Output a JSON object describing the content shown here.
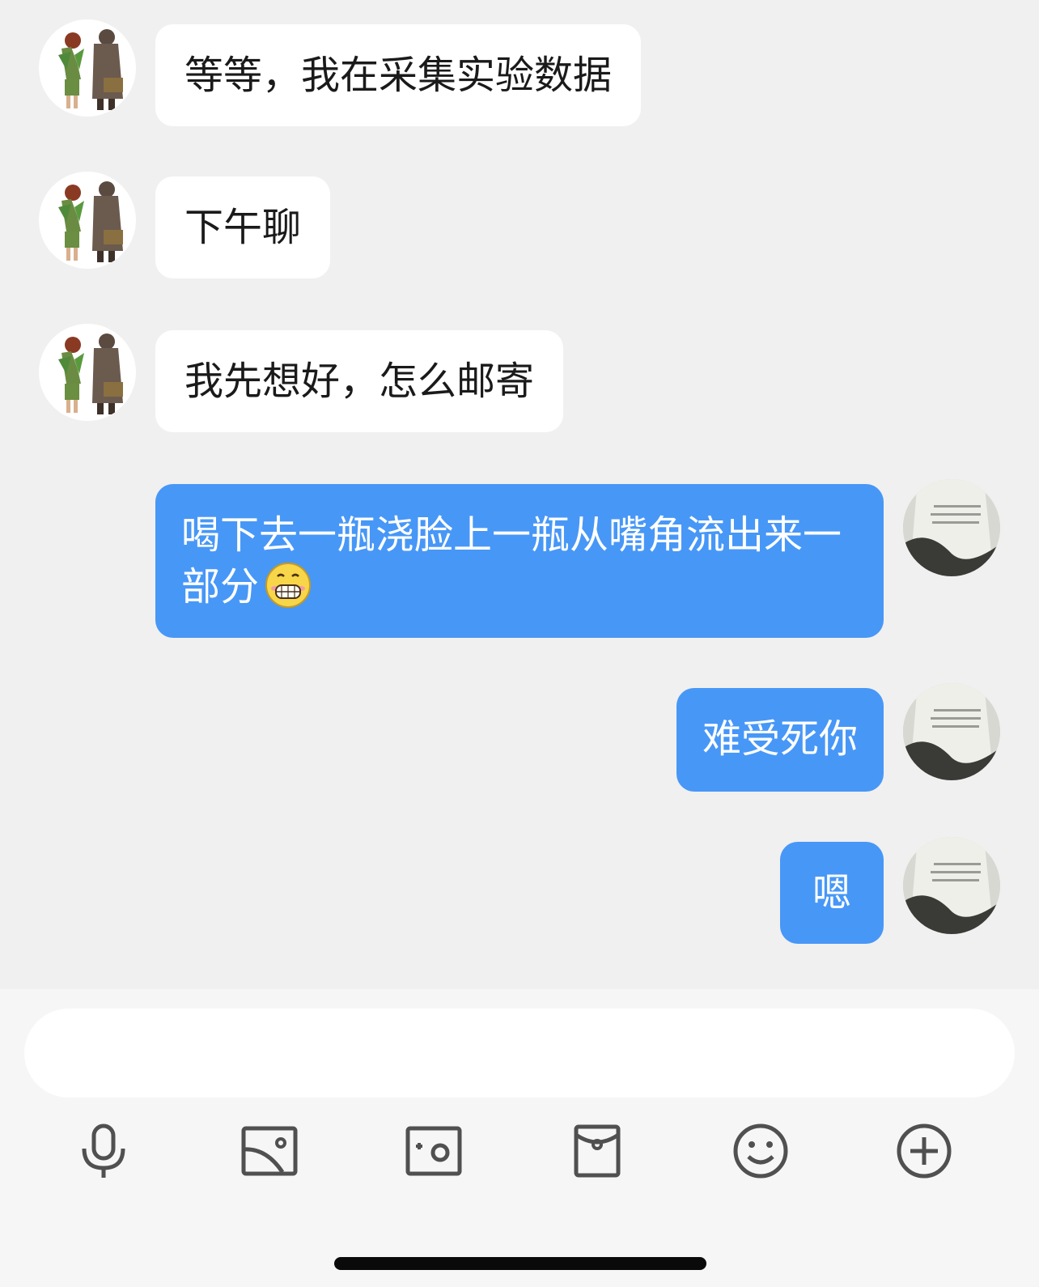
{
  "messages": [
    {
      "direction": "incoming",
      "text": "等等，我在采集实验数据"
    },
    {
      "direction": "incoming",
      "text": "下午聊"
    },
    {
      "direction": "incoming",
      "text": "我先想好，怎么邮寄"
    },
    {
      "direction": "outgoing",
      "text": "喝下去一瓶浇脸上一瓶从嘴角流出来一部分",
      "emoji": "grinning-face-emoji"
    },
    {
      "direction": "outgoing",
      "text": "难受死你"
    },
    {
      "direction": "outgoing",
      "text": "嗯"
    }
  ],
  "composer": {
    "input_value": "",
    "placeholder": ""
  },
  "toolbar": {
    "icons": [
      "microphone-icon",
      "image-icon",
      "camera-icon",
      "red-packet-icon",
      "emoji-icon",
      "add-icon"
    ]
  },
  "colors": {
    "background": "#f0f0f0",
    "incoming_bubble": "#ffffff",
    "outgoing_bubble": "#4797f7",
    "icon": "#505050"
  }
}
